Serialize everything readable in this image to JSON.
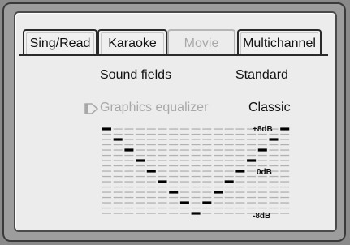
{
  "tabs": [
    {
      "label": "Sing/Read",
      "disabled": false
    },
    {
      "label": "Karaoke",
      "disabled": false
    },
    {
      "label": "Movie",
      "disabled": true
    },
    {
      "label": "Multichannel",
      "disabled": false
    }
  ],
  "sound_fields": {
    "label": "Sound fields",
    "value": "Standard"
  },
  "graphics_equalizer": {
    "label": "Graphics equalizer",
    "value": "Classic",
    "disabled": true
  },
  "equalizer": {
    "scale": {
      "top": "+8dB",
      "mid": "0dB",
      "bottom": "-8dB"
    },
    "levels_db": [
      8,
      6,
      4,
      2,
      0,
      -2,
      -4,
      -6,
      -8,
      -6,
      -4,
      -2,
      0,
      2,
      4,
      6,
      8
    ],
    "steps": 17
  },
  "colors": {
    "screen": "#ececec",
    "bezel": "#9d9d9d",
    "bar": "#b2b2b2",
    "marker": "#000000"
  }
}
